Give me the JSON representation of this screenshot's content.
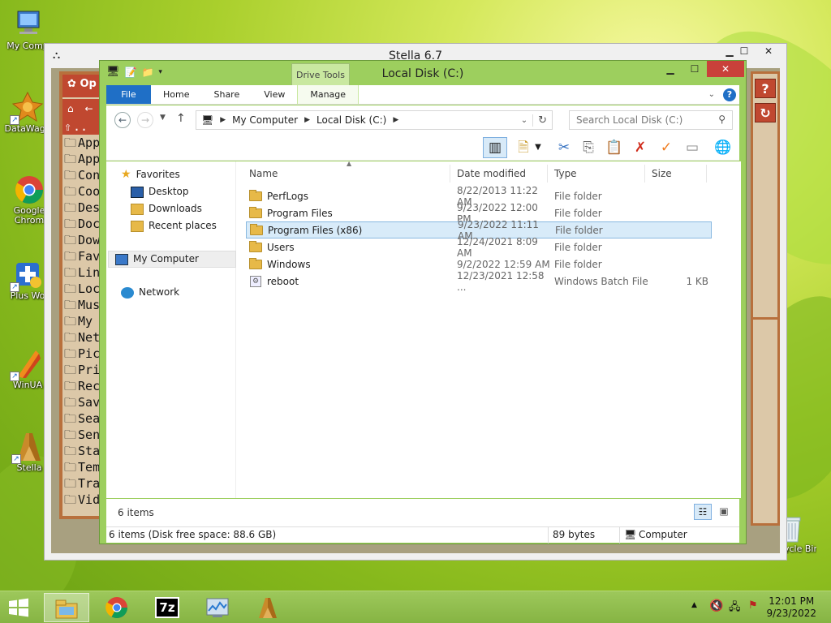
{
  "desktop": {
    "icons": [
      {
        "label": "My Comp",
        "icon": "computer-icon"
      },
      {
        "label": "DataWago",
        "icon": "datawagon-icon"
      },
      {
        "label": "Google Chrom",
        "icon": "chrome-icon"
      },
      {
        "label": "Plus Wo",
        "icon": "plus-icon"
      },
      {
        "label": "WinUA",
        "icon": "winuae-icon"
      },
      {
        "label": "Stella",
        "icon": "stella-icon"
      },
      {
        "label": "Recycle Bin",
        "icon": "recycle-bin-icon"
      }
    ]
  },
  "stella": {
    "title": "Stella 6.7",
    "panel_header": "Op",
    "files": [
      {
        "label": ".."
      },
      {
        "label": "App"
      },
      {
        "label": "App"
      },
      {
        "label": "Con"
      },
      {
        "label": "Coo"
      },
      {
        "label": "Des"
      },
      {
        "label": "Doc"
      },
      {
        "label": "Dow"
      },
      {
        "label": "Fav"
      },
      {
        "label": "Lin"
      },
      {
        "label": "Loc"
      },
      {
        "label": "Mus"
      },
      {
        "label": "My"
      },
      {
        "label": "Net"
      },
      {
        "label": "Pic"
      },
      {
        "label": "Pri"
      },
      {
        "label": "Rec"
      },
      {
        "label": "Sav"
      },
      {
        "label": "Sea"
      },
      {
        "label": "Sen"
      },
      {
        "label": "Sta"
      },
      {
        "label": "Tem"
      },
      {
        "label": "Tra"
      },
      {
        "label": "Vid"
      }
    ],
    "help_label": "?",
    "reload_label": "C"
  },
  "explorer": {
    "title": "Local Disk (C:)",
    "context_tab": "Drive Tools",
    "ribbon_tabs": [
      "File",
      "Home",
      "Share",
      "View",
      "Manage"
    ],
    "breadcrumb": [
      "My Computer",
      "Local Disk (C:)"
    ],
    "search_placeholder": "Search Local Disk (C:)",
    "nav": {
      "favorites": "Favorites",
      "fav_items": [
        "Desktop",
        "Downloads",
        "Recent places"
      ],
      "computer": "My Computer",
      "network": "Network"
    },
    "columns": [
      "Name",
      "Date modified",
      "Type",
      "Size"
    ],
    "rows": [
      {
        "name": "PerfLogs",
        "date": "8/22/2013 11:22 AM",
        "type": "File folder",
        "size": ""
      },
      {
        "name": "Program Files",
        "date": "9/23/2022 12:00 PM",
        "type": "File folder",
        "size": ""
      },
      {
        "name": "Program Files (x86)",
        "date": "9/23/2022 11:11 AM",
        "type": "File folder",
        "size": ""
      },
      {
        "name": "Users",
        "date": "12/24/2021 8:09 AM",
        "type": "File folder",
        "size": ""
      },
      {
        "name": "Windows",
        "date": "9/2/2022 12:59 AM",
        "type": "File folder",
        "size": ""
      },
      {
        "name": "reboot",
        "date": "12/23/2021 12:58 ...",
        "type": "Windows Batch File",
        "size": "1 KB"
      }
    ],
    "item_count": "6 items",
    "status_left": "6 items (Disk free space: 88.6 GB)",
    "status_size": "89 bytes",
    "status_location": "Computer"
  },
  "taskbar": {
    "apps": [
      "file-explorer-icon",
      "chrome-icon",
      "7zip-icon",
      "task-manager-icon",
      "stella-icon"
    ],
    "sevenzip_label": "7z",
    "time": "12:01 PM",
    "date": "9/23/2022"
  }
}
